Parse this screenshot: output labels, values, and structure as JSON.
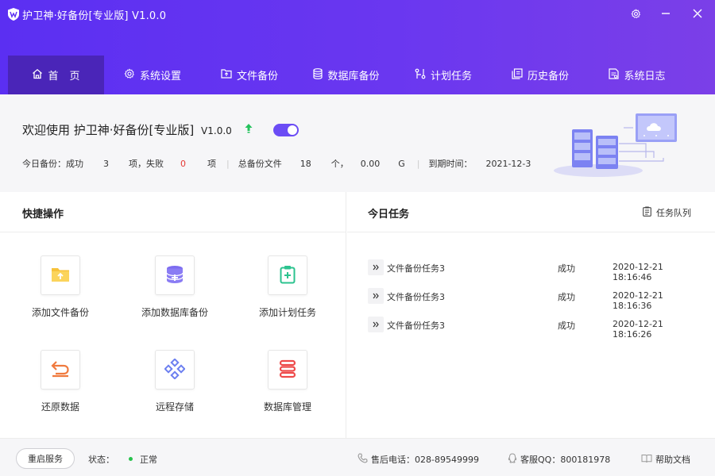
{
  "app": {
    "title": "护卫神·好备份[专业版]  V1.0.0"
  },
  "nav": [
    {
      "label": "首页",
      "icon": "home-icon"
    },
    {
      "label": "系统设置",
      "icon": "gear-icon"
    },
    {
      "label": "文件备份",
      "icon": "folder-upload-icon"
    },
    {
      "label": "数据库备份",
      "icon": "database-icon"
    },
    {
      "label": "计划任务",
      "icon": "schedule-icon"
    },
    {
      "label": "历史备份",
      "icon": "history-icon"
    },
    {
      "label": "系统日志",
      "icon": "log-icon"
    }
  ],
  "welcome": {
    "title": "欢迎使用 护卫神·好备份[专业版]",
    "version": "V1.0.0",
    "toggle_on": true,
    "stats": {
      "today_label": "今日备份：成功",
      "success_count": "3",
      "fail_label": "项，失败",
      "fail_count": "0",
      "item_unit": "项",
      "total_label": "总备份文件",
      "file_count": "18",
      "file_unit": "个，",
      "size_value": "0.00",
      "size_unit": "G",
      "expire_label": "到期时间：",
      "expire_date": "2021-12-3"
    }
  },
  "quick": {
    "title": "快捷操作",
    "items": [
      {
        "label": "添加文件备份",
        "icon": "folder-add-icon"
      },
      {
        "label": "添加数据库备份",
        "icon": "database-add-icon"
      },
      {
        "label": "添加计划任务",
        "icon": "clipboard-add-icon"
      },
      {
        "label": "还原数据",
        "icon": "restore-icon"
      },
      {
        "label": "远程存储",
        "icon": "remote-storage-icon"
      },
      {
        "label": "数据库管理",
        "icon": "database-manage-icon"
      }
    ]
  },
  "tasks": {
    "title": "今日任务",
    "queue_label": "任务队列",
    "rows": [
      {
        "name": "文件备份任务3",
        "status": "成功",
        "time": "2020-12-21 18:16:46"
      },
      {
        "name": "文件备份任务3",
        "status": "成功",
        "time": "2020-12-21 18:16:36"
      },
      {
        "name": "文件备份任务3",
        "status": "成功",
        "time": "2020-12-21 18:16:26"
      }
    ]
  },
  "footer": {
    "restart_label": "重启服务",
    "status_label": "状态：",
    "status_value": "正常",
    "phone": "售后电话：028-89549999",
    "qq": "客服QQ：800181978",
    "help": "帮助文档"
  },
  "colors": {
    "header_start": "#5b2ff2",
    "header_end": "#7b3fe8",
    "nav_active": "#4a25b8",
    "accent": "#6b4cf5",
    "fail": "#e53935",
    "ok_dot": "#27c24c"
  }
}
